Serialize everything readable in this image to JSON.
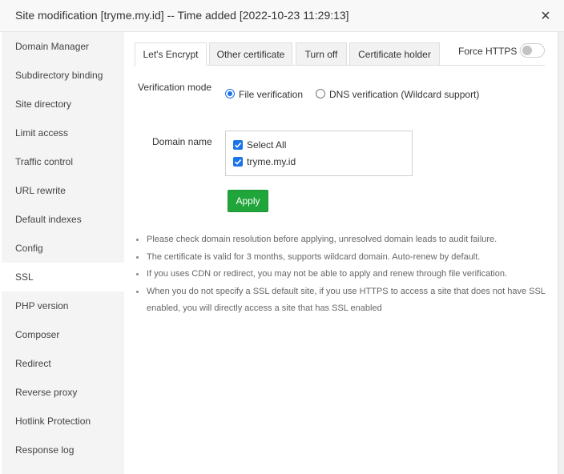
{
  "window": {
    "title": "Site modification [tryme.my.id] -- Time added [2022-10-23 11:29:13]",
    "close_symbol": "×"
  },
  "sidebar": {
    "items": [
      {
        "label": "Domain Manager"
      },
      {
        "label": "Subdirectory binding"
      },
      {
        "label": "Site directory"
      },
      {
        "label": "Limit access"
      },
      {
        "label": "Traffic control"
      },
      {
        "label": "URL rewrite"
      },
      {
        "label": "Default indexes"
      },
      {
        "label": "Config"
      },
      {
        "label": "SSL"
      },
      {
        "label": "PHP version"
      },
      {
        "label": "Composer"
      },
      {
        "label": "Redirect"
      },
      {
        "label": "Reverse proxy"
      },
      {
        "label": "Hotlink Protection"
      },
      {
        "label": "Response log"
      }
    ],
    "active": "SSL"
  },
  "tabs": [
    {
      "label": "Let's Encrypt"
    },
    {
      "label": "Other certificate"
    },
    {
      "label": "Turn off"
    },
    {
      "label": "Certificate holder"
    }
  ],
  "force_https": {
    "label": "Force HTTPS",
    "enabled": false
  },
  "verification": {
    "label": "Verification mode",
    "options": [
      {
        "label": "File verification"
      },
      {
        "label": "DNS verification (Wildcard support)"
      }
    ],
    "selected": "File verification"
  },
  "domain": {
    "label": "Domain name",
    "select_all": "Select All",
    "items": [
      {
        "label": "tryme.my.id"
      }
    ]
  },
  "apply_label": "Apply",
  "notes": [
    "Please check domain resolution before applying, unresolved domain leads to audit failure.",
    "The certificate is valid for 3 months, supports wildcard domain. Auto-renew by default.",
    "If you uses CDN or redirect, you may not be able to apply and renew through file verification.",
    "When you do not specify a SSL default site, if you use HTTPS to access a site that does not have SSL enabled, you will directly access a site that has SSL enabled"
  ],
  "colors": {
    "accent": "#1a73e8",
    "apply_button": "#20a53a"
  }
}
